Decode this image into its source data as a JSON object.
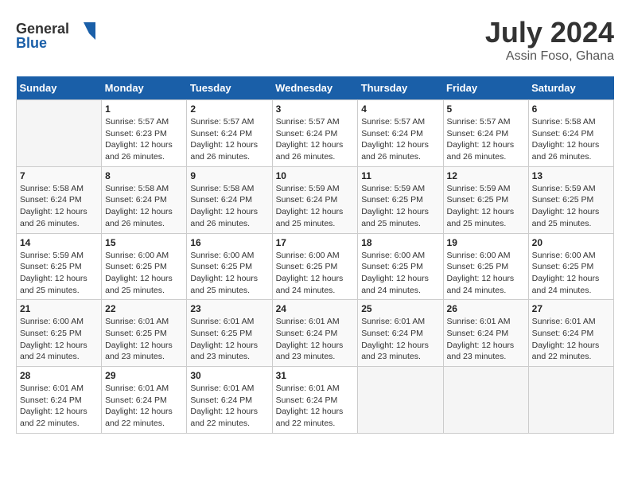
{
  "header": {
    "logo_general": "General",
    "logo_blue": "Blue",
    "title": "July 2024",
    "location": "Assin Foso, Ghana"
  },
  "days_of_week": [
    "Sunday",
    "Monday",
    "Tuesday",
    "Wednesday",
    "Thursday",
    "Friday",
    "Saturday"
  ],
  "weeks": [
    [
      {
        "day": "",
        "sunrise": "",
        "sunset": "",
        "daylight": ""
      },
      {
        "day": "1",
        "sunrise": "Sunrise: 5:57 AM",
        "sunset": "Sunset: 6:23 PM",
        "daylight": "Daylight: 12 hours and 26 minutes."
      },
      {
        "day": "2",
        "sunrise": "Sunrise: 5:57 AM",
        "sunset": "Sunset: 6:24 PM",
        "daylight": "Daylight: 12 hours and 26 minutes."
      },
      {
        "day": "3",
        "sunrise": "Sunrise: 5:57 AM",
        "sunset": "Sunset: 6:24 PM",
        "daylight": "Daylight: 12 hours and 26 minutes."
      },
      {
        "day": "4",
        "sunrise": "Sunrise: 5:57 AM",
        "sunset": "Sunset: 6:24 PM",
        "daylight": "Daylight: 12 hours and 26 minutes."
      },
      {
        "day": "5",
        "sunrise": "Sunrise: 5:57 AM",
        "sunset": "Sunset: 6:24 PM",
        "daylight": "Daylight: 12 hours and 26 minutes."
      },
      {
        "day": "6",
        "sunrise": "Sunrise: 5:58 AM",
        "sunset": "Sunset: 6:24 PM",
        "daylight": "Daylight: 12 hours and 26 minutes."
      }
    ],
    [
      {
        "day": "7",
        "sunrise": "Sunrise: 5:58 AM",
        "sunset": "Sunset: 6:24 PM",
        "daylight": "Daylight: 12 hours and 26 minutes."
      },
      {
        "day": "8",
        "sunrise": "Sunrise: 5:58 AM",
        "sunset": "Sunset: 6:24 PM",
        "daylight": "Daylight: 12 hours and 26 minutes."
      },
      {
        "day": "9",
        "sunrise": "Sunrise: 5:58 AM",
        "sunset": "Sunset: 6:24 PM",
        "daylight": "Daylight: 12 hours and 26 minutes."
      },
      {
        "day": "10",
        "sunrise": "Sunrise: 5:59 AM",
        "sunset": "Sunset: 6:24 PM",
        "daylight": "Daylight: 12 hours and 25 minutes."
      },
      {
        "day": "11",
        "sunrise": "Sunrise: 5:59 AM",
        "sunset": "Sunset: 6:25 PM",
        "daylight": "Daylight: 12 hours and 25 minutes."
      },
      {
        "day": "12",
        "sunrise": "Sunrise: 5:59 AM",
        "sunset": "Sunset: 6:25 PM",
        "daylight": "Daylight: 12 hours and 25 minutes."
      },
      {
        "day": "13",
        "sunrise": "Sunrise: 5:59 AM",
        "sunset": "Sunset: 6:25 PM",
        "daylight": "Daylight: 12 hours and 25 minutes."
      }
    ],
    [
      {
        "day": "14",
        "sunrise": "Sunrise: 5:59 AM",
        "sunset": "Sunset: 6:25 PM",
        "daylight": "Daylight: 12 hours and 25 minutes."
      },
      {
        "day": "15",
        "sunrise": "Sunrise: 6:00 AM",
        "sunset": "Sunset: 6:25 PM",
        "daylight": "Daylight: 12 hours and 25 minutes."
      },
      {
        "day": "16",
        "sunrise": "Sunrise: 6:00 AM",
        "sunset": "Sunset: 6:25 PM",
        "daylight": "Daylight: 12 hours and 25 minutes."
      },
      {
        "day": "17",
        "sunrise": "Sunrise: 6:00 AM",
        "sunset": "Sunset: 6:25 PM",
        "daylight": "Daylight: 12 hours and 24 minutes."
      },
      {
        "day": "18",
        "sunrise": "Sunrise: 6:00 AM",
        "sunset": "Sunset: 6:25 PM",
        "daylight": "Daylight: 12 hours and 24 minutes."
      },
      {
        "day": "19",
        "sunrise": "Sunrise: 6:00 AM",
        "sunset": "Sunset: 6:25 PM",
        "daylight": "Daylight: 12 hours and 24 minutes."
      },
      {
        "day": "20",
        "sunrise": "Sunrise: 6:00 AM",
        "sunset": "Sunset: 6:25 PM",
        "daylight": "Daylight: 12 hours and 24 minutes."
      }
    ],
    [
      {
        "day": "21",
        "sunrise": "Sunrise: 6:00 AM",
        "sunset": "Sunset: 6:25 PM",
        "daylight": "Daylight: 12 hours and 24 minutes."
      },
      {
        "day": "22",
        "sunrise": "Sunrise: 6:01 AM",
        "sunset": "Sunset: 6:25 PM",
        "daylight": "Daylight: 12 hours and 23 minutes."
      },
      {
        "day": "23",
        "sunrise": "Sunrise: 6:01 AM",
        "sunset": "Sunset: 6:25 PM",
        "daylight": "Daylight: 12 hours and 23 minutes."
      },
      {
        "day": "24",
        "sunrise": "Sunrise: 6:01 AM",
        "sunset": "Sunset: 6:24 PM",
        "daylight": "Daylight: 12 hours and 23 minutes."
      },
      {
        "day": "25",
        "sunrise": "Sunrise: 6:01 AM",
        "sunset": "Sunset: 6:24 PM",
        "daylight": "Daylight: 12 hours and 23 minutes."
      },
      {
        "day": "26",
        "sunrise": "Sunrise: 6:01 AM",
        "sunset": "Sunset: 6:24 PM",
        "daylight": "Daylight: 12 hours and 23 minutes."
      },
      {
        "day": "27",
        "sunrise": "Sunrise: 6:01 AM",
        "sunset": "Sunset: 6:24 PM",
        "daylight": "Daylight: 12 hours and 22 minutes."
      }
    ],
    [
      {
        "day": "28",
        "sunrise": "Sunrise: 6:01 AM",
        "sunset": "Sunset: 6:24 PM",
        "daylight": "Daylight: 12 hours and 22 minutes."
      },
      {
        "day": "29",
        "sunrise": "Sunrise: 6:01 AM",
        "sunset": "Sunset: 6:24 PM",
        "daylight": "Daylight: 12 hours and 22 minutes."
      },
      {
        "day": "30",
        "sunrise": "Sunrise: 6:01 AM",
        "sunset": "Sunset: 6:24 PM",
        "daylight": "Daylight: 12 hours and 22 minutes."
      },
      {
        "day": "31",
        "sunrise": "Sunrise: 6:01 AM",
        "sunset": "Sunset: 6:24 PM",
        "daylight": "Daylight: 12 hours and 22 minutes."
      },
      {
        "day": "",
        "sunrise": "",
        "sunset": "",
        "daylight": ""
      },
      {
        "day": "",
        "sunrise": "",
        "sunset": "",
        "daylight": ""
      },
      {
        "day": "",
        "sunrise": "",
        "sunset": "",
        "daylight": ""
      }
    ]
  ]
}
